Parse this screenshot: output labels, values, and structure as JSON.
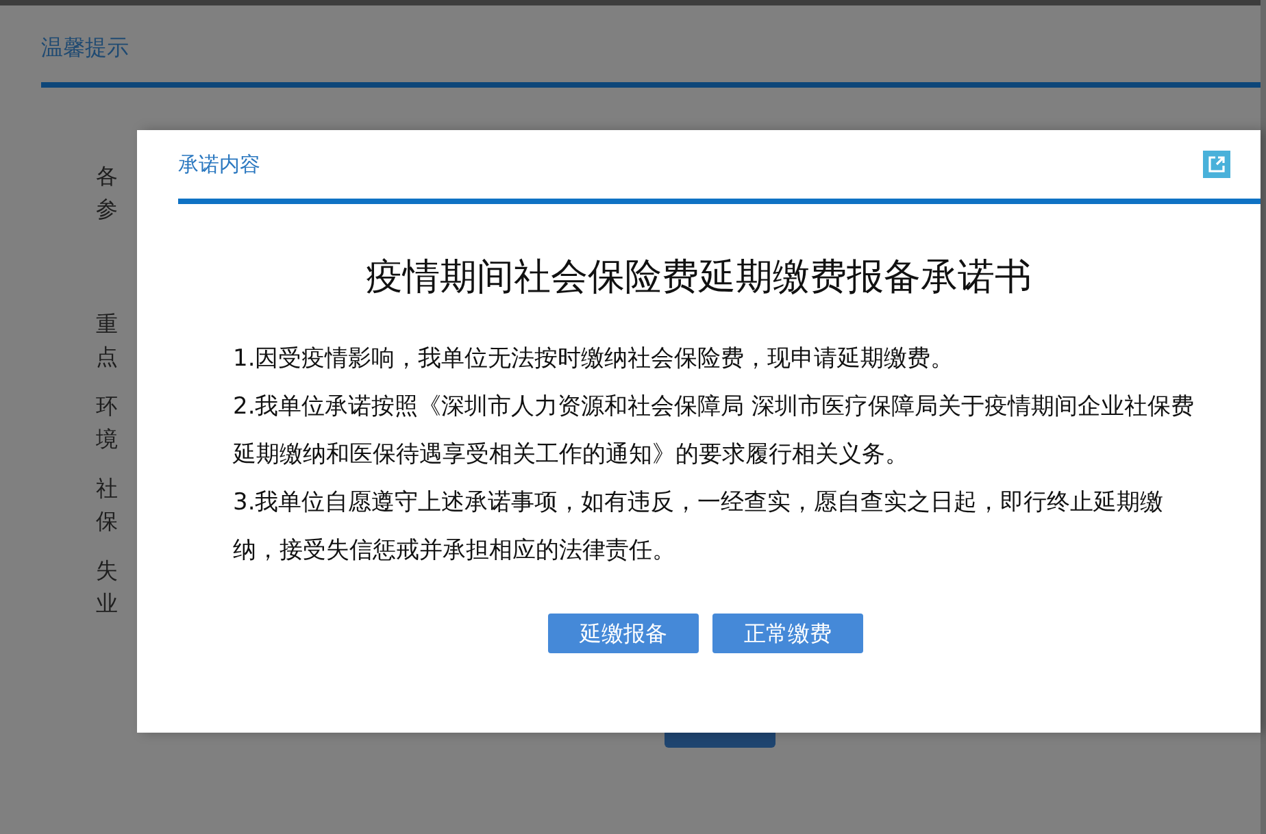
{
  "page": {
    "header": "温馨提示",
    "side_items": [
      "各参",
      "重点",
      "环境",
      "社保",
      "失业"
    ]
  },
  "dialog": {
    "title": "承诺内容",
    "heading": "疫情期间社会保险费延期缴费报备承诺书",
    "paragraphs": [
      "1.因受疫情影响，我单位无法按时缴纳社会保险费，现申请延期缴费。",
      "2.我单位承诺按照《深圳市人力资源和社会保障局 深圳市医疗保障局关于疫情期间企业社保费延期缴纳和医保待遇享受相关工作的通知》的要求履行相关义务。",
      "3.我单位自愿遵守上述承诺事项，如有违反，一经查实，愿自查实之日起，即行终止延期缴纳，接受失信惩戒并承担相应的法律责任。"
    ],
    "buttons": [
      "延缴报备",
      "正常缴费"
    ]
  }
}
